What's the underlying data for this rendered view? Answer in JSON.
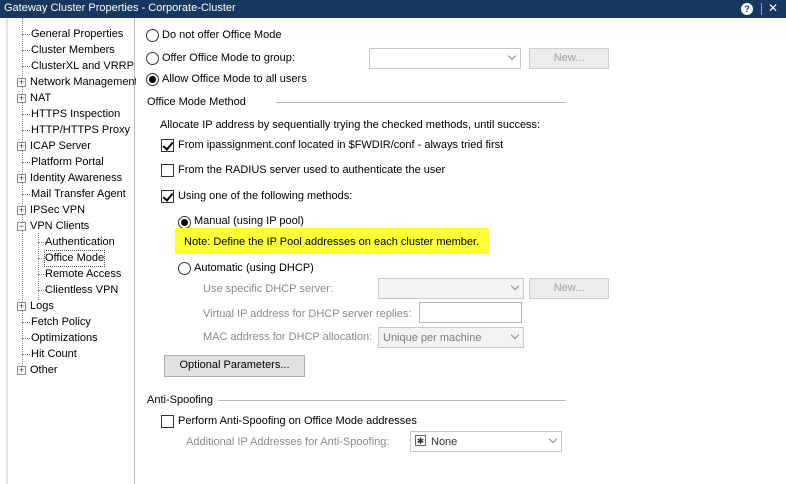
{
  "window": {
    "title": "Gateway Cluster Properties - Corporate-Cluster",
    "help_glyph": "?",
    "close_glyph": "✕"
  },
  "tree": {
    "items": [
      {
        "label": "General Properties"
      },
      {
        "label": "Cluster Members"
      },
      {
        "label": "ClusterXL and VRRP"
      },
      {
        "label": "Network Management"
      },
      {
        "label": "NAT"
      },
      {
        "label": "HTTPS Inspection"
      },
      {
        "label": "HTTP/HTTPS Proxy"
      },
      {
        "label": "ICAP Server"
      },
      {
        "label": "Platform Portal"
      },
      {
        "label": "Identity Awareness"
      },
      {
        "label": "Mail Transfer Agent"
      },
      {
        "label": "IPSec VPN"
      },
      {
        "label": "VPN Clients"
      },
      {
        "label": "Authentication"
      },
      {
        "label": "Office Mode"
      },
      {
        "label": "Remote Access"
      },
      {
        "label": "Clientless VPN"
      },
      {
        "label": "Logs"
      },
      {
        "label": "Fetch Policy"
      },
      {
        "label": "Optimizations"
      },
      {
        "label": "Hit Count"
      },
      {
        "label": "Other"
      }
    ],
    "plus_glyph": "+",
    "minus_glyph": "−"
  },
  "office_mode": {
    "opt_none": "Do not offer Office Mode",
    "opt_group": "Offer Office Mode to group:",
    "opt_all": "Allow Office Mode to all users",
    "group_value": "",
    "group_new": "New..."
  },
  "method": {
    "title": "Office Mode Method",
    "intro": "Allocate IP address by sequentially trying the checked methods, until success:",
    "ipassign": "From ipassignment.conf located in $FWDIR/conf - always tried first",
    "radius": "From the RADIUS server used to authenticate the user",
    "using": "Using one of the following methods:",
    "manual": "Manual (using IP pool)",
    "note": "Note: Define the IP Pool addresses on each cluster member.",
    "automatic": "Automatic (using DHCP)",
    "dhcp_server_label": "Use specific DHCP server:",
    "dhcp_server_value": "",
    "dhcp_new": "New...",
    "virtual_ip_label": "Virtual IP address for DHCP server replies:",
    "virtual_ip_value": "",
    "mac_label": "MAC address for DHCP allocation:",
    "mac_value": "Unique per machine",
    "optional_params": "Optional Parameters..."
  },
  "anti_spoofing": {
    "title": "Anti-Spoofing",
    "perform": "Perform Anti-Spoofing on Office Mode addresses",
    "additional_label": "Additional IP Addresses for Anti-Spoofing:",
    "additional_value": "None",
    "additional_icon": "✱"
  }
}
